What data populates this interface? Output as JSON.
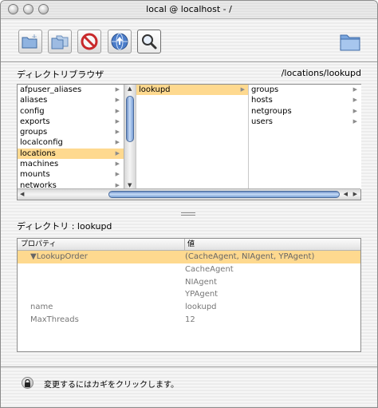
{
  "window": {
    "title": "local @ localhost - /"
  },
  "toolbar": {
    "buttons": [
      {
        "name": "new-directory-button",
        "icon": "new-folder-icon"
      },
      {
        "name": "duplicate-button",
        "icon": "duplicate-icon"
      },
      {
        "name": "delete-button",
        "icon": "no-entry-icon"
      },
      {
        "name": "go-to-parent-button",
        "icon": "globe-arrow-icon"
      },
      {
        "name": "search-button",
        "icon": "magnifier-icon"
      }
    ],
    "folder_icon": "folder-icon"
  },
  "browser": {
    "section_label": "ディレクトリブラウザ",
    "path": "/locations/lookupd",
    "col1": [
      "afpuser_aliases",
      "aliases",
      "config",
      "exports",
      "groups",
      "localconfig",
      "locations",
      "machines",
      "mounts",
      "networks"
    ],
    "col1_selected": "locations",
    "col2": [
      "lookupd"
    ],
    "col2_selected": "lookupd",
    "col3": [
      "groups",
      "hosts",
      "netgroups",
      "users"
    ]
  },
  "directory": {
    "label": "ディレクトリ : lookupd"
  },
  "properties": {
    "header_property": "プロパティ",
    "header_value": "値",
    "rows": [
      {
        "key": "▼LookupOrder",
        "value": "(CacheAgent, NIAgent, YPAgent)",
        "selected": true
      },
      {
        "key": "",
        "value": "CacheAgent"
      },
      {
        "key": "",
        "value": "NIAgent"
      },
      {
        "key": "",
        "value": "YPAgent"
      },
      {
        "key": "name",
        "value": "lookupd"
      },
      {
        "key": "MaxThreads",
        "value": "12"
      }
    ]
  },
  "footer": {
    "lock_text": "変更するにはカギをクリックします。"
  },
  "colors": {
    "selection": "#fed98f",
    "scroll_thumb": "#7aa0d6"
  }
}
